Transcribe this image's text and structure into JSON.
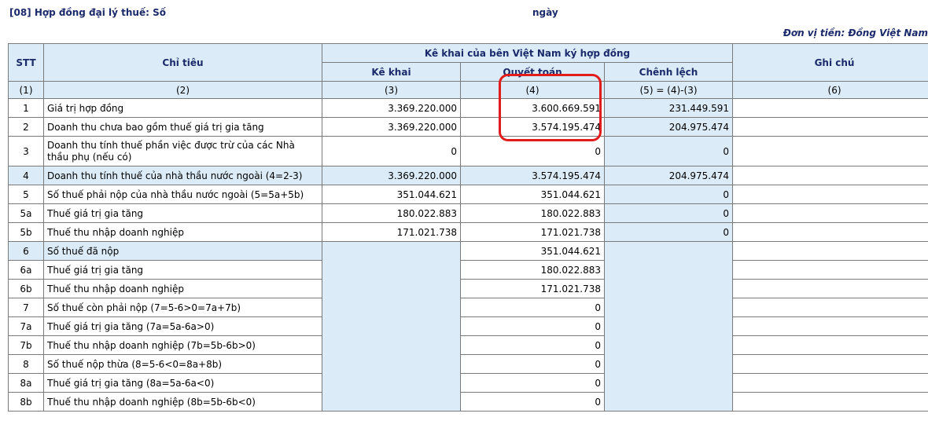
{
  "header": {
    "contract_line": "[08] Hợp đồng đại lý thuế: Số",
    "date_label": "ngày",
    "unit": "Đơn vị tiền: Đồng Việt Nam"
  },
  "table": {
    "col_stt": "STT",
    "col_chitieu": "Chỉ tiêu",
    "group_header": "Kê khai của bên Việt Nam ký hợp đồng",
    "col_kekhai": "Kê khai",
    "col_quyettoan": "Quyết toán",
    "col_chenhlech": "Chênh lệch",
    "col_ghichu": "Ghi chú",
    "index_row": [
      "(1)",
      "(2)",
      "(3)",
      "(4)",
      "(5) = (4)-(3)",
      "(6)"
    ],
    "rows": [
      {
        "stt": "1",
        "label": "Giá trị hợp đồng",
        "kekhai": "3.369.220.000",
        "quyettoan": "3.600.669.591",
        "chenhlech": "231.449.591",
        "ghichu": ""
      },
      {
        "stt": "2",
        "label": "Doanh thu chưa bao gồm thuế giá trị gia tăng",
        "kekhai": "3.369.220.000",
        "quyettoan": "3.574.195.474",
        "chenhlech": "204.975.474",
        "ghichu": ""
      },
      {
        "stt": "3",
        "label": "Doanh thu tính thuế phần việc được trừ của các Nhà thầu phụ (nếu có)",
        "kekhai": "0",
        "quyettoan": "0",
        "chenhlech": "0",
        "ghichu": ""
      },
      {
        "stt": "4",
        "label": "Doanh thu tính thuế của nhà thầu nước ngoài (4=2-3)",
        "kekhai": "3.369.220.000",
        "quyettoan": "3.574.195.474",
        "chenhlech": "204.975.474",
        "ghichu": ""
      },
      {
        "stt": "5",
        "label": "Số thuế phải nộp của nhà thầu nước ngoài (5=5a+5b)",
        "kekhai": "351.044.621",
        "quyettoan": "351.044.621",
        "chenhlech": "0",
        "ghichu": ""
      },
      {
        "stt": "5a",
        "label": "Thuế giá trị gia tăng",
        "kekhai": "180.022.883",
        "quyettoan": "180.022.883",
        "chenhlech": "0",
        "ghichu": ""
      },
      {
        "stt": "5b",
        "label": "Thuế thu nhập doanh nghiệp",
        "kekhai": "171.021.738",
        "quyettoan": "171.021.738",
        "chenhlech": "0",
        "ghichu": ""
      },
      {
        "stt": "6",
        "label": "Số thuế đã nộp",
        "quyettoan": "351.044.621",
        "ghichu": ""
      },
      {
        "stt": "6a",
        "label": "Thuế giá trị gia tăng",
        "quyettoan": "180.022.883",
        "ghichu": ""
      },
      {
        "stt": "6b",
        "label": "Thuế thu nhập doanh nghiệp",
        "quyettoan": "171.021.738",
        "ghichu": ""
      },
      {
        "stt": "7",
        "label": "Số thuế còn phải nộp (7=5-6>0=7a+7b)",
        "quyettoan": "0",
        "ghichu": ""
      },
      {
        "stt": "7a",
        "label": "Thuế giá trị gia tăng (7a=5a-6a>0)",
        "quyettoan": "0",
        "ghichu": ""
      },
      {
        "stt": "7b",
        "label": "Thuế thu nhập doanh nghiệp (7b=5b-6b>0)",
        "quyettoan": "0",
        "ghichu": ""
      },
      {
        "stt": "8",
        "label": "Số thuế nộp thừa (8=5-6<0=8a+8b)",
        "quyettoan": "0",
        "ghichu": ""
      },
      {
        "stt": "8a",
        "label": "Thuế giá trị gia tăng (8a=5a-6a<0)",
        "quyettoan": "0",
        "ghichu": ""
      },
      {
        "stt": "8b",
        "label": "Thuế thu nhập doanh nghiệp (8b=5b-6b<0)",
        "quyettoan": "0",
        "ghichu": ""
      }
    ]
  },
  "colors": {
    "header_bg": "#dbecf8",
    "header_text": "#1b2a6b",
    "highlight": "#e21b1b",
    "border": "#7a7a7a"
  }
}
